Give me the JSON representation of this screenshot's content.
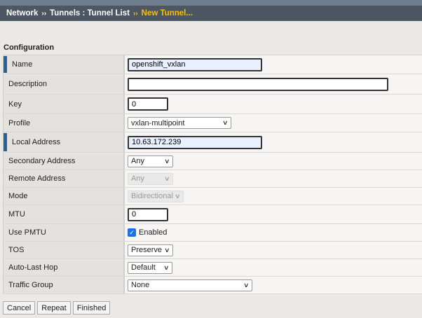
{
  "breadcrumb": {
    "items": [
      "Network",
      "Tunnels : Tunnel List"
    ],
    "current": "New Tunnel...",
    "separator": "››"
  },
  "section_title": "Configuration",
  "fields": {
    "name": {
      "label": "Name",
      "value": "openshift_vxlan"
    },
    "description": {
      "label": "Description",
      "value": ""
    },
    "key": {
      "label": "Key",
      "value": "0"
    },
    "profile": {
      "label": "Profile",
      "value": "vxlan-multipoint"
    },
    "local_address": {
      "label": "Local Address",
      "value": "10.63.172.239"
    },
    "secondary_address": {
      "label": "Secondary Address",
      "value": "Any"
    },
    "remote_address": {
      "label": "Remote Address",
      "value": "Any"
    },
    "mode": {
      "label": "Mode",
      "value": "Bidirectional"
    },
    "mtu": {
      "label": "MTU",
      "value": "0"
    },
    "use_pmtu": {
      "label": "Use PMTU",
      "value": "Enabled",
      "checked": true
    },
    "tos": {
      "label": "TOS",
      "value": "Preserve"
    },
    "auto_last_hop": {
      "label": "Auto-Last Hop",
      "value": "Default"
    },
    "traffic_group": {
      "label": "Traffic Group",
      "value": "None"
    }
  },
  "buttons": {
    "cancel": "Cancel",
    "repeat": "Repeat",
    "finished": "Finished"
  },
  "colors": {
    "header": "#4d5663",
    "current_crumb": "#f5c200",
    "required_marker": "#2f5f9a"
  }
}
